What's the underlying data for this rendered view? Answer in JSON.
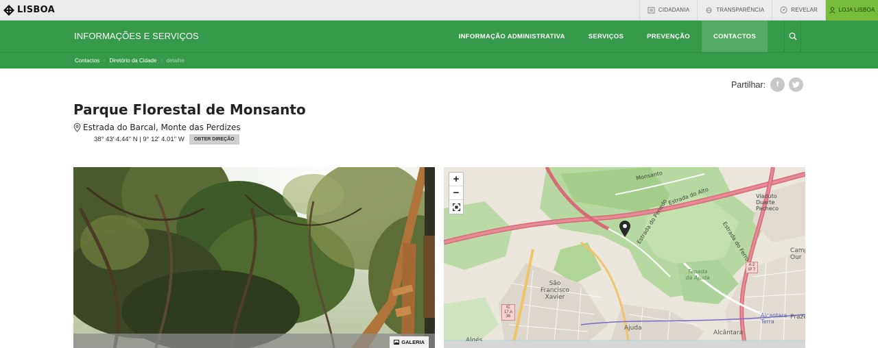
{
  "brand": {
    "name": "LISBOA"
  },
  "top_links": [
    {
      "label": "Cidadania",
      "icon": "building-icon"
    },
    {
      "label": "Transparência",
      "icon": "transparency-icon"
    },
    {
      "label": "Revelar",
      "icon": "compass-icon"
    },
    {
      "label": "Loja Lisboa",
      "icon": "user-icon"
    }
  ],
  "nav": {
    "section_title": "INFORMAÇÕES E SERVIÇOS",
    "links": [
      "Informação administrativa",
      "Serviços",
      "Prevenção",
      "Contactos"
    ],
    "active": "Contactos"
  },
  "breadcrumb": [
    "Contactos",
    "Diretório da Cidade",
    "detalhe"
  ],
  "share": {
    "label": "Partilhar:",
    "networks": [
      "facebook-icon",
      "twitter-icon"
    ]
  },
  "place": {
    "title": "Parque Florestal de Monsanto",
    "address": "Estrada do Barcal, Monte das Perdizes",
    "coords": "38° 43' 4.44'' N | 9° 12' 4.01'' W",
    "directions_label": "OBTER DIREÇÃO"
  },
  "gallery": {
    "label": "GALERIA"
  },
  "map": {
    "zoom_in": "+",
    "zoom_out": "−",
    "labels": {
      "estrada_alto": "Estrada do Alto",
      "estrada_penedo": "Estrada do Penedo",
      "estrada_ferro": "Estrada do Ferro",
      "viaduto": "Viaduto Duarte Pacheco",
      "sao_francisco": "São Francisco Xavier",
      "tapada": "Tapada da Ajuda",
      "ajuda": "Ajuda",
      "alcantara": "Alcântara",
      "alcantara_terra": "Alcantara Terra",
      "alges": "Algés",
      "campo": "Camp Our",
      "praze": "Praze",
      "monsanto": "Monsanto"
    },
    "badges": {
      "ic17": "IC 17 A 36",
      "a2": "A 2 IP 7"
    }
  },
  "colors": {
    "brand_green": "#359a4a",
    "accent_green": "#76bb3a",
    "topbar": "#ebebeb"
  }
}
